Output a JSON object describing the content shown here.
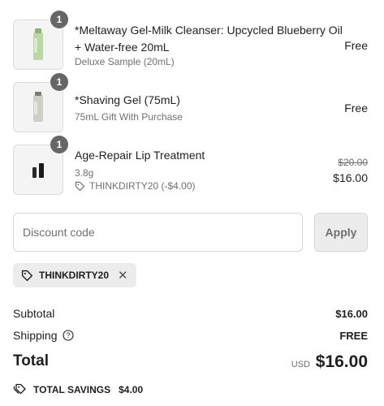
{
  "items": [
    {
      "icon": "gel-tube-product-icon",
      "quantity": "1",
      "title": "*Meltaway Gel-Milk Cleanser: Upcycled Blueberry Oil + Water-free 20mL",
      "subtitle": "Deluxe Sample (20mL)",
      "price": "Free"
    },
    {
      "icon": "shaving-gel-tube-product-icon",
      "quantity": "1",
      "title": "*Shaving Gel (75mL)",
      "subtitle": "75mL Gift With Purchase",
      "price": "Free"
    },
    {
      "icon": "lip-treatment-product-icon",
      "quantity": "1",
      "title": "Age-Repair Lip Treatment",
      "subtitle": "3.8g",
      "discount": "THINKDIRTY20 (-$4.00)",
      "original_price": "$20.00",
      "price": "$16.00"
    }
  ],
  "discount": {
    "placeholder": "Discount code",
    "apply_label": "Apply",
    "applied_code": "THINKDIRTY20"
  },
  "summary": {
    "subtotal_label": "Subtotal",
    "subtotal_value": "$16.00",
    "shipping_label": "Shipping",
    "shipping_value": "FREE",
    "total_label": "Total",
    "currency": "USD",
    "total_value": "$16.00",
    "savings_label": "TOTAL SAVINGS",
    "savings_value": "$4.00"
  },
  "colors": {
    "badge": "#666666",
    "muted_text": "#707070",
    "chip_bg": "#ececec"
  }
}
